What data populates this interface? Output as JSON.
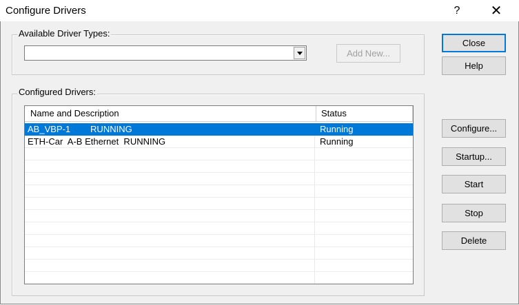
{
  "window": {
    "title": "Configure Drivers",
    "help_glyph": "?",
    "close_glyph": "✕"
  },
  "available": {
    "group_label": "Available Driver Types:",
    "selected_value": "",
    "add_new_label": "Add New..."
  },
  "configured": {
    "group_label": "Configured Drivers:",
    "columns": [
      "Name and Description",
      "Status"
    ],
    "rows": [
      {
        "name": "AB_VBP-1        RUNNING",
        "status": "Running",
        "selected": true
      },
      {
        "name": "ETH-Car  A-B Ethernet  RUNNING",
        "status": "Running",
        "selected": false
      }
    ]
  },
  "buttons": {
    "close": "Close",
    "help": "Help",
    "configure": "Configure...",
    "startup": "Startup...",
    "start": "Start",
    "stop": "Stop",
    "delete": "Delete"
  },
  "colors": {
    "selection": "#0078d7",
    "dialog_bg": "#f0f0f0"
  }
}
